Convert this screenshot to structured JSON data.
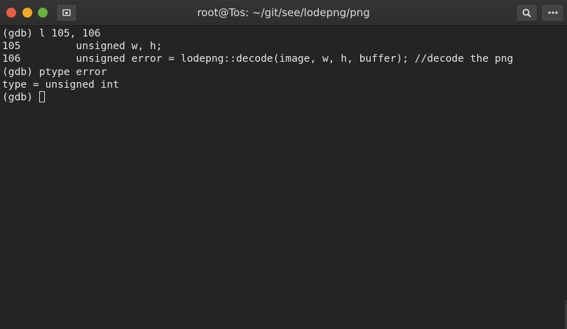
{
  "window": {
    "title": "root@Tos: ~/git/see/lodepng/png",
    "colors": {
      "titlebar": "#2f2f2f",
      "terminal_bg": "#242424",
      "text": "#e4e4e4",
      "close": "#e95d43",
      "minimize": "#f4a823",
      "maximize": "#6ab23c"
    }
  },
  "toolbar": {
    "new_tab_icon": "new-tab-icon",
    "search_icon": "search-icon",
    "menu_icon": "menu-icon"
  },
  "terminal": {
    "lines": [
      "(gdb) l 105, 106",
      "105\t    unsigned w, h;",
      "106\t    unsigned error = lodepng::decode(image, w, h, buffer); //decode the png",
      "(gdb) ptype error",
      "type = unsigned int"
    ],
    "prompt": "(gdb) "
  }
}
